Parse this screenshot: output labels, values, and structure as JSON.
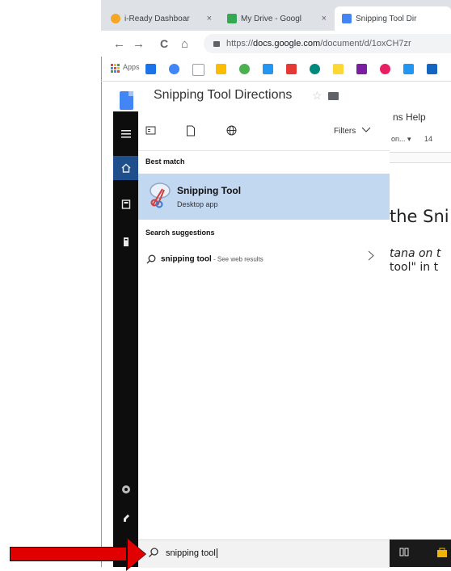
{
  "browser": {
    "tabs": [
      {
        "label": "i-Ready Dashboar",
        "icon": "iready-favicon",
        "color": "#f5a623"
      },
      {
        "label": "My Drive - Googl",
        "icon": "drive-favicon",
        "color": "#34a853"
      },
      {
        "label": "Snipping Tool Dir",
        "icon": "docs-favicon",
        "color": "#4285f4"
      }
    ],
    "tab_close": "×",
    "nav": {
      "back": "←",
      "forward": "→",
      "reload": "C",
      "home": "⌂"
    },
    "url_scheme": "https://",
    "url_host": "docs.google.com",
    "url_path": "/document/d/1oxCH7zr",
    "apps_label": "Apps",
    "bookmark_colors": [
      "#1a73e8",
      "#4285f4",
      "#ffffff",
      "#fbbc04",
      "#4caf50",
      "#2196f3",
      "#e53935",
      "#00897b",
      "#fdd835",
      "#7b1fa2",
      "#e91e63",
      "#2196f3",
      "#1565c0"
    ]
  },
  "doc": {
    "title": "Snipping Tool Directions",
    "star": "☆",
    "menu_help": "ns Help",
    "font_partial": "on... ▾",
    "font_size": "14",
    "body_lines": [
      "the Sni",
      "tana on t",
      "tool\" in t"
    ]
  },
  "start_menu": {
    "rail_icons": [
      "hamburger-icon",
      "home-icon",
      "document-icon",
      "tower-icon"
    ],
    "bottom_icons": [
      "settings-icon",
      "power-icon"
    ],
    "top_icons": [
      "apps-view-icon",
      "document-view-icon",
      "web-globe-icon"
    ],
    "filters_label": "Filters",
    "best_match_heading": "Best match",
    "best_match": {
      "title": "Snipping Tool",
      "subtitle": "Desktop app"
    },
    "suggestions_heading": "Search suggestions",
    "suggestion": {
      "query": "snipping tool",
      "suffix": " - See web results"
    },
    "search_value": "snipping tool"
  },
  "colors": {
    "match_bg": "#c2d7f0",
    "rail_bg": "#0d0d0d",
    "selected_rail": "#1e4f8c",
    "arrow": "#e00000"
  }
}
